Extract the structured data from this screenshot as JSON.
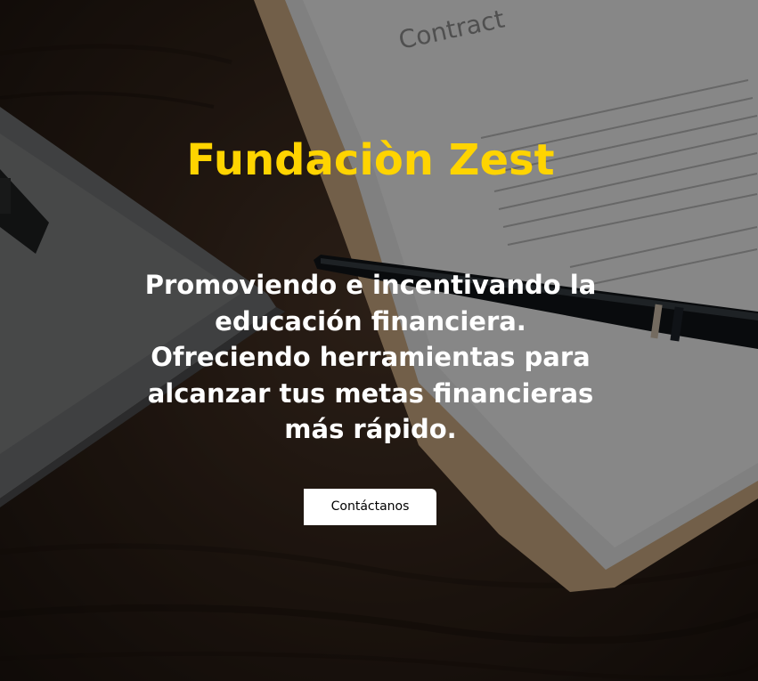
{
  "hero": {
    "title": "Fundaciòn Zest",
    "subtitle": "Promoviendo e incentivando la educación financiera. Ofreciendo herramientas para alcanzar tus metas financieras más rápido.",
    "cta_label": "Contáctanos"
  },
  "background": {
    "document_heading": "Contract",
    "document_text_lines": [
      "...",
      "..."
    ]
  },
  "colors": {
    "title": "#ffd400",
    "subtitle": "#ffffff",
    "button_bg": "#ffffff",
    "button_text": "#000000"
  }
}
